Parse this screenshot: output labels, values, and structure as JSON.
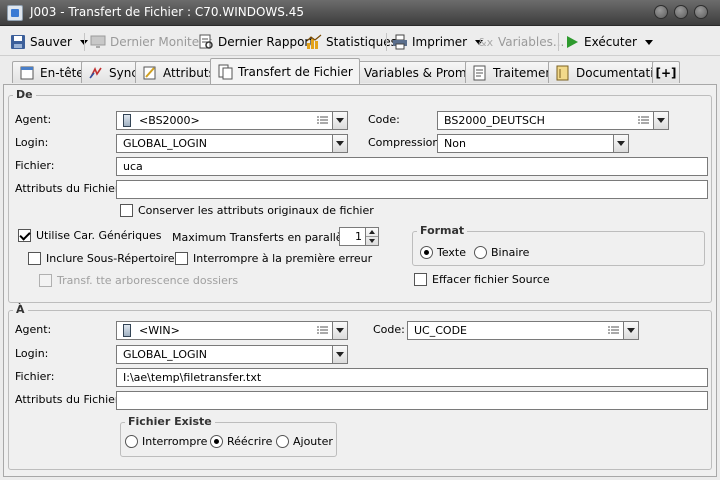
{
  "window": {
    "title": "J003 - Transfert de Fichier : C70.WINDOWS.45"
  },
  "toolbar": {
    "save": "Sauver",
    "last_monitor": "Dernier Moniteur",
    "last_report": "Dernier Rapport",
    "statistics": "Statistiques",
    "print": "Imprimer",
    "variables": "Variables...",
    "execute": "Exécuter"
  },
  "tabs": [
    {
      "label": "En-tête"
    },
    {
      "label": "Sync"
    },
    {
      "label": "Attributs"
    },
    {
      "label": "Transfert de Fichier"
    },
    {
      "label": "Variables & Prompts"
    },
    {
      "label": "Traitement"
    },
    {
      "label": "Documentation"
    },
    {
      "label": "[+]"
    }
  ],
  "source": {
    "legend": "De",
    "agent_label": "Agent:",
    "agent_value": "<BS2000>",
    "code_label": "Code:",
    "code_value": "BS2000_DEUTSCH",
    "login_label": "Login:",
    "login_value": "GLOBAL_LOGIN",
    "compression_label": "Compression:",
    "compression_value": "Non",
    "file_label": "Fichier:",
    "file_value": "uca",
    "attrs_label": "Attributs du Fichier:",
    "attrs_value": "",
    "keep_attrs": "Conserver les attributs originaux de fichier",
    "wildcards": "Utilise Car. Génériques",
    "max_transfers_label": "Maximum Transferts en parallèle:",
    "max_transfers_value": "1",
    "include_subdirs": "Inclure Sous-Répertoires",
    "stop_on_error": "Interrompre à la première erreur",
    "transfer_tree": "Transf. tte arborescence dossiers",
    "format": {
      "legend": "Format",
      "text": "Texte",
      "binary": "Binaire"
    },
    "delete_source": "Effacer fichier Source"
  },
  "destination": {
    "legend": "À",
    "agent_label": "Agent:",
    "agent_value": "<WIN>",
    "code_label": "Code:",
    "code_value": "UC_CODE",
    "login_label": "Login:",
    "login_value": "GLOBAL_LOGIN",
    "file_label": "Fichier:",
    "file_value": "I:\\ae\\temp\\filetransfer.txt",
    "attrs_label": "Attributs du Fichier:",
    "attrs_value": "",
    "exists": {
      "legend": "Fichier Existe",
      "abort": "Interrompre",
      "overwrite": "Réécrire",
      "append": "Ajouter"
    }
  }
}
